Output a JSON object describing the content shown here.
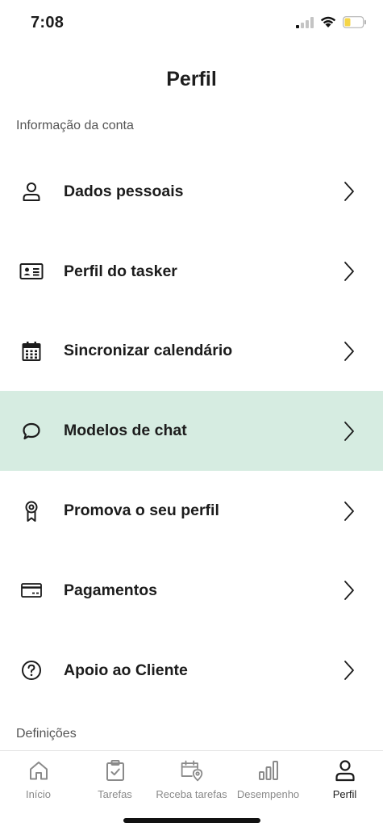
{
  "status_bar": {
    "time": "7:08",
    "icons": [
      "cellular-signal-icon",
      "wifi-icon",
      "battery-icon"
    ],
    "battery_color": "#f5d547"
  },
  "header": {
    "title": "Perfil"
  },
  "sections": {
    "account": "Informação da conta",
    "settings": "Definições"
  },
  "menu": {
    "items": [
      {
        "label": "Dados pessoais",
        "icon": "person-icon"
      },
      {
        "label": "Perfil do tasker",
        "icon": "id-card-icon"
      },
      {
        "label": "Sincronizar calendário",
        "icon": "calendar-icon"
      },
      {
        "label": "Modelos de chat",
        "icon": "chat-bubble-icon",
        "highlighted": true
      },
      {
        "label": "Promova o seu perfil",
        "icon": "award-ribbon-icon"
      },
      {
        "label": "Pagamentos",
        "icon": "credit-card-icon"
      },
      {
        "label": "Apoio ao Cliente",
        "icon": "help-circle-icon"
      }
    ]
  },
  "tab_bar": {
    "tabs": [
      {
        "label": "Início",
        "icon": "home-icon"
      },
      {
        "label": "Tarefas",
        "icon": "clipboard-check-icon"
      },
      {
        "label": "Receba tarefas",
        "icon": "calendar-location-icon"
      },
      {
        "label": "Desempenho",
        "icon": "bar-chart-icon"
      },
      {
        "label": "Perfil",
        "icon": "person-icon",
        "active": true
      }
    ]
  },
  "colors": {
    "highlight": "#d6ece1",
    "text": "#1c1c1c",
    "muted": "#8a8a8a"
  }
}
